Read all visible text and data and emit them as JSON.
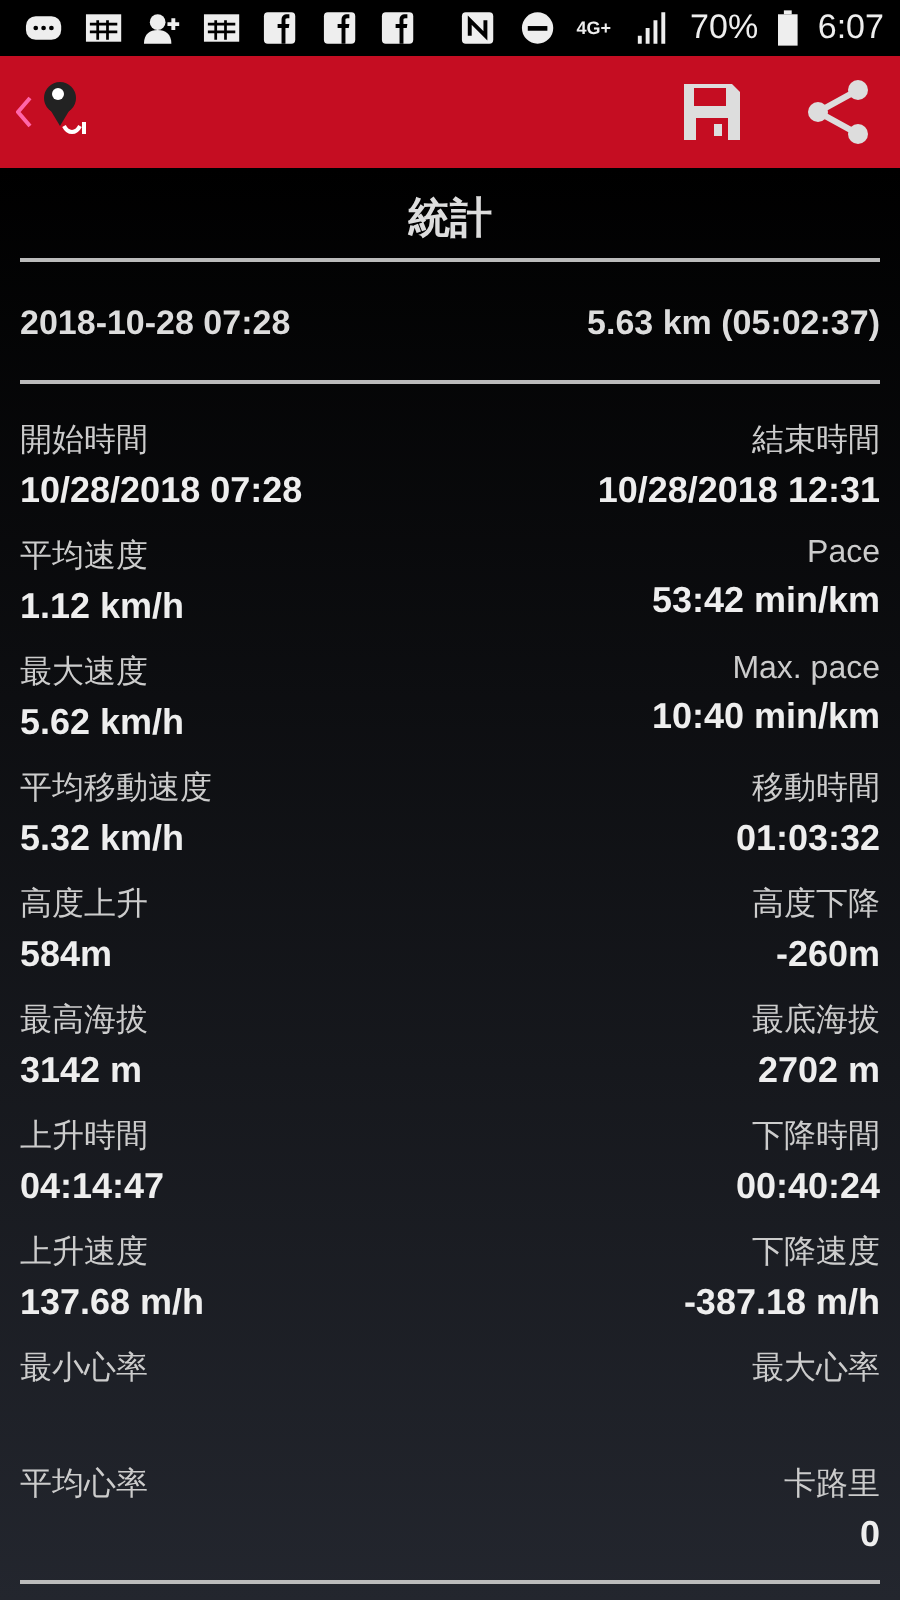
{
  "status_bar": {
    "network": "4G+",
    "battery": "70%",
    "time": "6:07"
  },
  "title": "統計",
  "summary": {
    "date": "2018-10-28 07:28",
    "distance": "5.63 km (05:02:37)"
  },
  "stats": [
    {
      "left": {
        "label": "開始時間",
        "value": "10/28/2018 07:28"
      },
      "right": {
        "label": "結束時間",
        "value": "10/28/2018 12:31"
      }
    },
    {
      "left": {
        "label": "平均速度",
        "value": "1.12 km/h"
      },
      "right": {
        "label": "Pace",
        "value": "53:42 min/km"
      }
    },
    {
      "left": {
        "label": "最大速度",
        "value": "5.62 km/h"
      },
      "right": {
        "label": "Max. pace",
        "value": "10:40 min/km"
      }
    },
    {
      "left": {
        "label": "平均移動速度",
        "value": "5.32 km/h"
      },
      "right": {
        "label": "移動時間",
        "value": "01:03:32"
      }
    },
    {
      "left": {
        "label": "高度上升",
        "value": "584m"
      },
      "right": {
        "label": "高度下降",
        "value": "-260m"
      }
    },
    {
      "left": {
        "label": "最高海拔",
        "value": "3142 m"
      },
      "right": {
        "label": "最底海拔",
        "value": "2702 m"
      }
    },
    {
      "left": {
        "label": "上升時間",
        "value": "04:14:47"
      },
      "right": {
        "label": "下降時間",
        "value": "00:40:24"
      }
    },
    {
      "left": {
        "label": "上升速度",
        "value": "137.68 m/h"
      },
      "right": {
        "label": "下降速度",
        "value": "-387.18 m/h"
      }
    },
    {
      "left": {
        "label": "最小心率"
      },
      "right": {
        "label": "最大心率"
      }
    },
    {
      "left": {
        "label": "平均心率"
      },
      "right": {
        "label": "卡路里",
        "value": "0"
      }
    }
  ]
}
